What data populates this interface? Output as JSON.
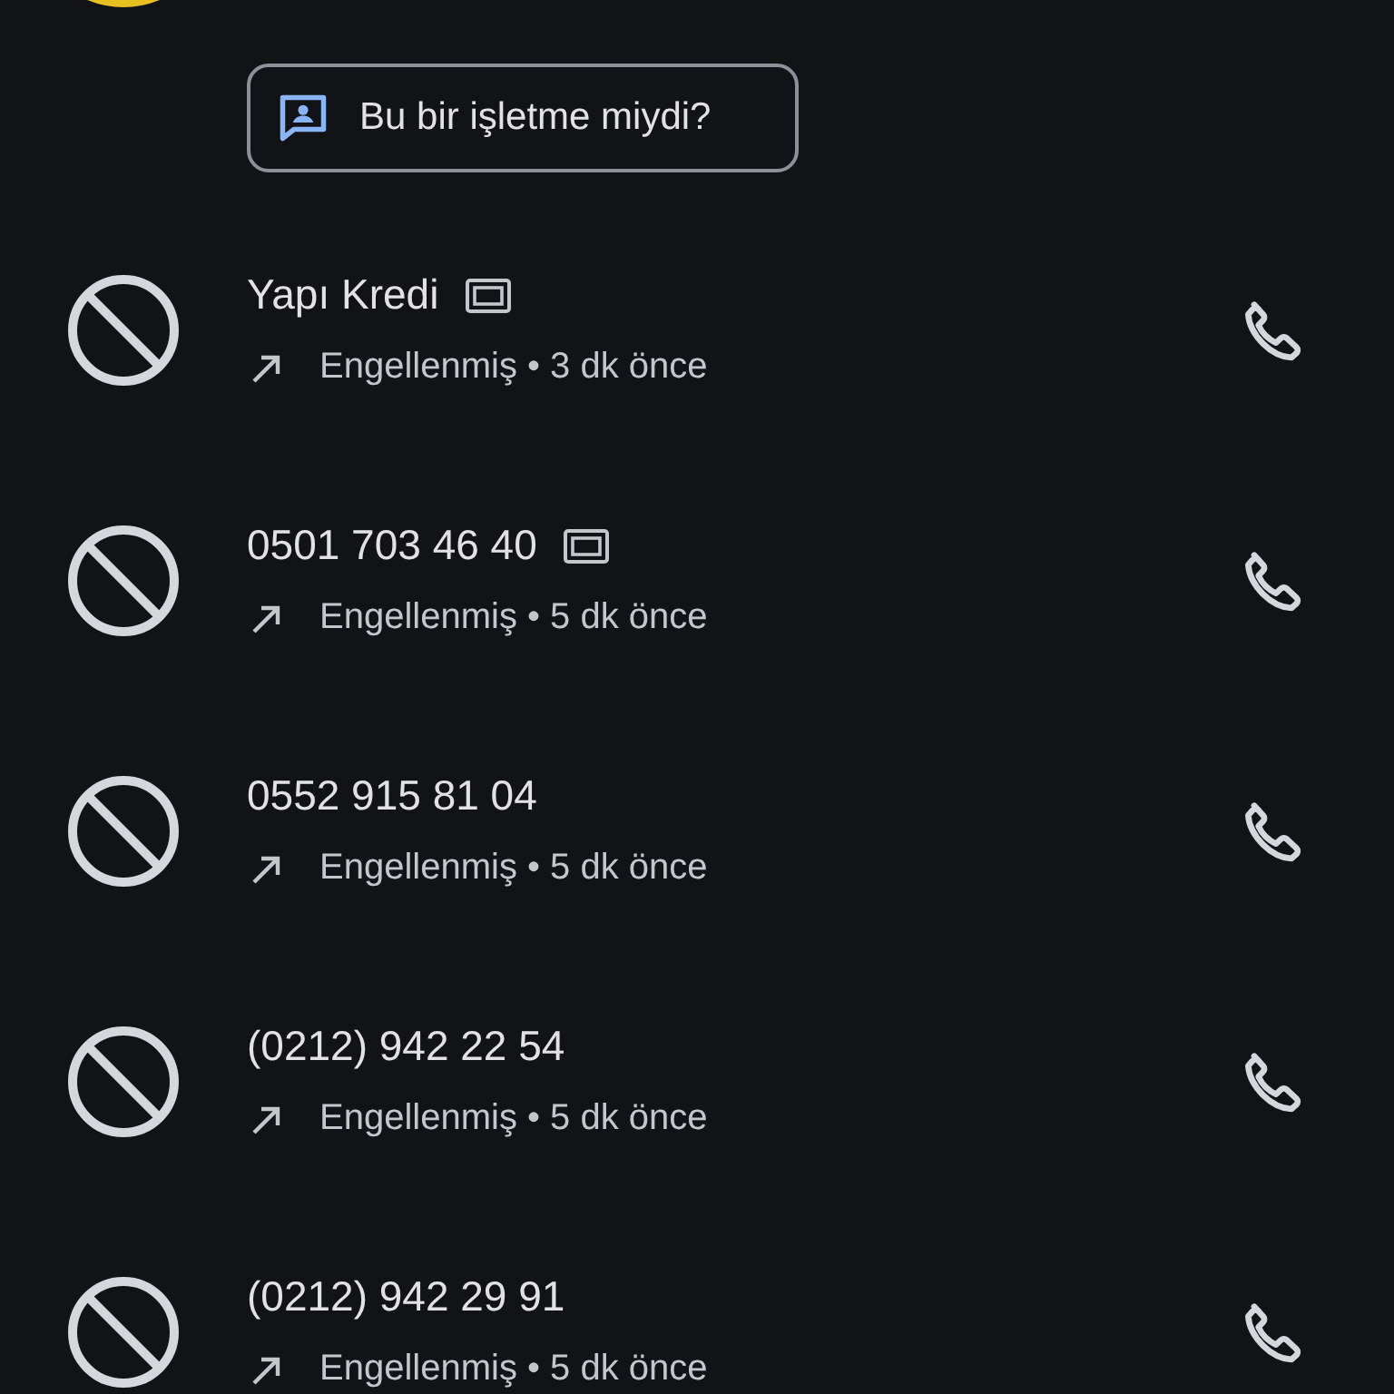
{
  "business_prompt": {
    "label": "Bu bir işletme miydi?"
  },
  "calls": [
    {
      "name": "Yapı Kredi",
      "hd": true,
      "kind": "outgoing",
      "status": "Engellenmiş • 3 dk önce"
    },
    {
      "name": "0501 703 46 40",
      "hd": true,
      "kind": "outgoing",
      "status": "Engellenmiş • 5 dk önce"
    },
    {
      "name": "0552 915 81 04",
      "hd": false,
      "kind": "outgoing",
      "status": "Engellenmiş • 5 dk önce"
    },
    {
      "name": "(0212) 942 22 54",
      "hd": false,
      "kind": "outgoing",
      "status": "Engellenmiş • 5 dk önce"
    },
    {
      "name": "(0212) 942 29 91",
      "hd": false,
      "kind": "outgoing",
      "status": "Engellenmiş • 5 dk önce"
    }
  ]
}
